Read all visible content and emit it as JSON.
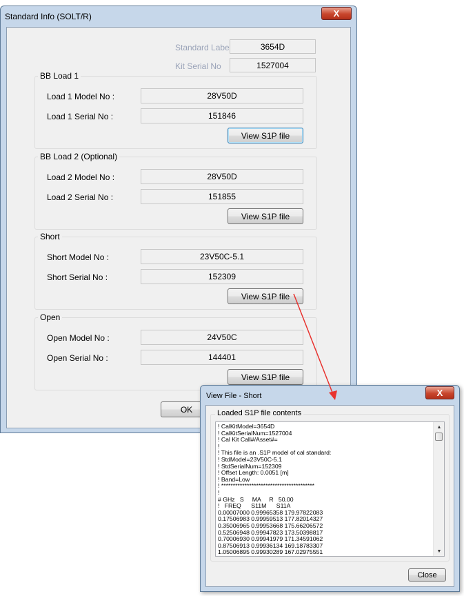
{
  "main_window": {
    "title": "Standard Info (SOLT/R)",
    "close_glyph": "X",
    "standard_label_caption": "Standard Label",
    "standard_label_value": "3654D",
    "kit_serial_caption": "Kit Serial No",
    "kit_serial_value": "1527004",
    "groups": [
      {
        "legend": "BB Load 1",
        "model_label": "Load 1 Model No :",
        "model_value": "28V50D",
        "serial_label": "Load 1 Serial No  :",
        "serial_value": "151846",
        "button": "View S1P file"
      },
      {
        "legend": "BB Load 2 (Optional)",
        "model_label": "Load 2 Model No :",
        "model_value": "28V50D",
        "serial_label": "Load 2 Serial No  :",
        "serial_value": "151855",
        "button": "View S1P file"
      },
      {
        "legend": "Short",
        "model_label": "Short Model No :",
        "model_value": "23V50C-5.1",
        "serial_label": "Short Serial No  :",
        "serial_value": "152309",
        "button": "View S1P file"
      },
      {
        "legend": "Open",
        "model_label": "Open Model No :",
        "model_value": "24V50C",
        "serial_label": "Open Serial No  :",
        "serial_value": "144401",
        "button": "View S1P file"
      }
    ],
    "ok_button": "OK"
  },
  "file_window": {
    "title": "View File - Short",
    "close_glyph": "X",
    "group_legend": "Loaded S1P file contents",
    "lines": [
      "! CalKitModel=3654D",
      "! CalKitSerialNum=1527004",
      "! Cal Kit Call#/Asset#=",
      "!",
      "! This file is an .S1P model of cal standard:",
      "! StdModel=23V50C-5.1",
      "! StdSerialNum=152309",
      "! Offset Length: 0.0051 [m]",
      "! Band=Low",
      "! ****************************************",
      "!",
      "# GHz   S     MA     R   50.00",
      "!   FREQ      S11M      S11A",
      "0.00007000 0.99965358 179.97822083",
      "0.17506983 0.99959513 177.82014327",
      "0.35006965 0.99953668 175.66206572",
      "0.52506948 0.99947823 173.50398817",
      "0.70006930 0.99941979 171.34591062",
      "0.87506913 0.99936134 169.18783307",
      "1.05006895 0.99930289 167.02975551"
    ],
    "close_button": "Close",
    "scroll_up_glyph": "▲",
    "scroll_down_glyph": "▼"
  },
  "colors": {
    "arrow": "#e8332f",
    "window_frame": "#c6d7ea"
  }
}
